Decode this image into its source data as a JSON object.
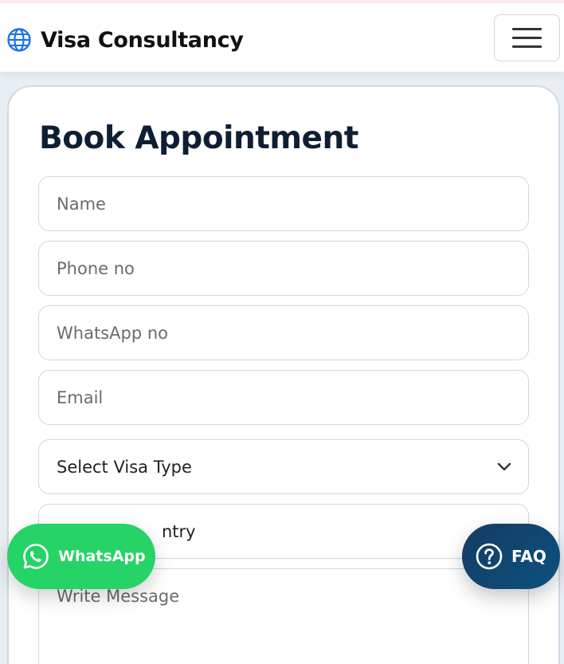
{
  "header": {
    "brand_icon": "globe-icon",
    "brand_name": "Visa Consultancy",
    "menu_icon": "hamburger-menu-icon"
  },
  "form": {
    "title": "Book Appointment",
    "name_placeholder": "Name",
    "phone_placeholder": "Phone no",
    "whatsapp_placeholder": "WhatsApp no",
    "email_placeholder": "Email",
    "visa_type_selected": "Select Visa Type",
    "country_partial": "ntry",
    "message_placeholder": "Write Message"
  },
  "floating": {
    "whatsapp_label": "WhatsApp",
    "whatsapp_icon": "whatsapp-icon",
    "faq_label": "FAQ",
    "faq_icon": "question-circle-icon"
  },
  "colors": {
    "whatsapp_green": "#25d366",
    "faq_navy": "#0f4470",
    "title_text": "#0f1f33",
    "brand_icon_blue": "#1a73e8"
  }
}
